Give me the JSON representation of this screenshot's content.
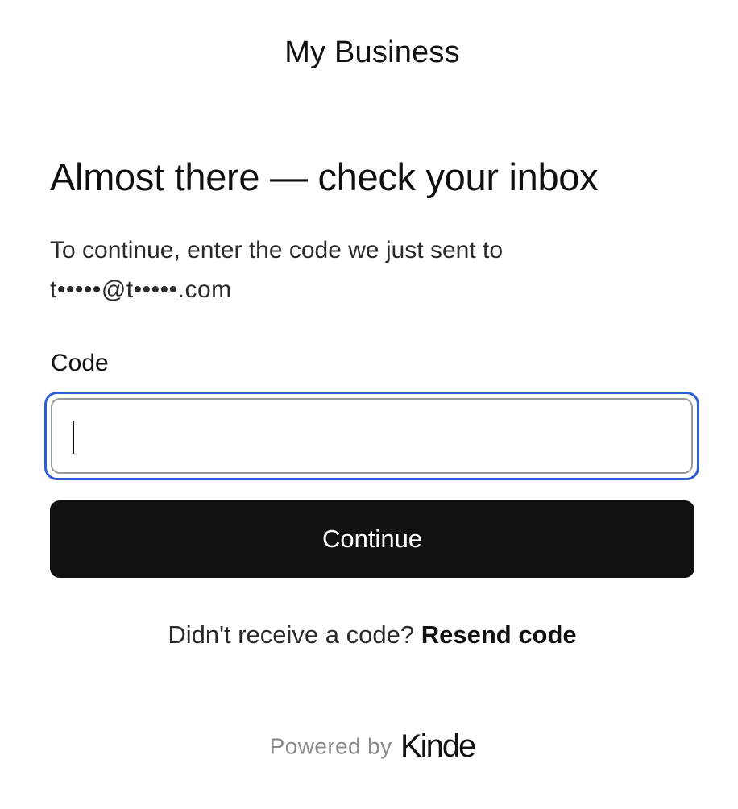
{
  "brand": {
    "title": "My Business"
  },
  "main": {
    "heading": "Almost there — check your inbox",
    "description": "To continue, enter the code we just sent to",
    "masked_email": "t•••••@t•••••.com"
  },
  "form": {
    "code_label": "Code",
    "code_value": "",
    "code_placeholder": "",
    "focus_color": "#2f5fd6",
    "continue_label": "Continue",
    "continue_color": "#111111"
  },
  "resend": {
    "prompt": "Didn't receive a code?",
    "link_label": "Resend code"
  },
  "footer": {
    "powered_by": "Powered by",
    "logo_text": "Kinde"
  }
}
